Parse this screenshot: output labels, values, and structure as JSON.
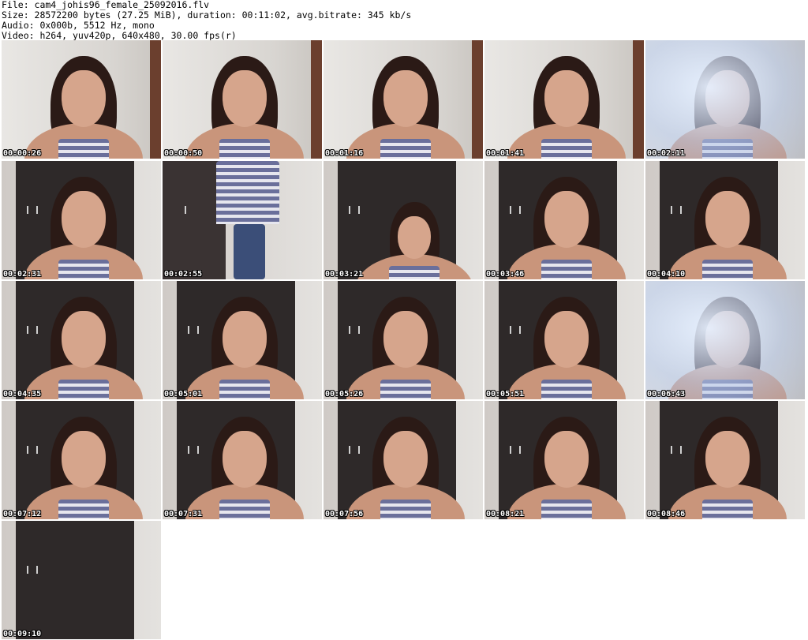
{
  "info": {
    "file": "File: cam4_johis96_female_25092016.flv",
    "size": "Size: 28572200 bytes (27.25 MiB), duration: 00:11:02, avg.bitrate: 345 kb/s",
    "audio": "Audio: 0x000b, 5512 Hz, mono",
    "video": "Video: h264, yuv420p, 640x480, 30.00 fps(r)"
  },
  "thumbnails": [
    {
      "time": "00:00:26",
      "scene": "bright"
    },
    {
      "time": "00:00:50",
      "scene": "bright"
    },
    {
      "time": "00:01:16",
      "scene": "bright"
    },
    {
      "time": "00:01:41",
      "scene": "bright"
    },
    {
      "time": "00:02:11",
      "scene": "glare"
    },
    {
      "time": "00:02:31",
      "scene": "dark-side"
    },
    {
      "time": "00:02:55",
      "scene": "standing"
    },
    {
      "time": "00:03:21",
      "scene": "dark-far"
    },
    {
      "time": "00:03:46",
      "scene": "dark"
    },
    {
      "time": "00:04:10",
      "scene": "dark"
    },
    {
      "time": "00:04:35",
      "scene": "dark"
    },
    {
      "time": "00:05:01",
      "scene": "dark"
    },
    {
      "time": "00:05:26",
      "scene": "dark"
    },
    {
      "time": "00:05:51",
      "scene": "dark"
    },
    {
      "time": "00:06:43",
      "scene": "glare"
    },
    {
      "time": "00:07:12",
      "scene": "dark"
    },
    {
      "time": "00:07:31",
      "scene": "dark"
    },
    {
      "time": "00:07:56",
      "scene": "dark"
    },
    {
      "time": "00:08:21",
      "scene": "dark"
    },
    {
      "time": "00:08:46",
      "scene": "dark"
    },
    {
      "time": "00:09:10",
      "scene": "empty"
    }
  ]
}
